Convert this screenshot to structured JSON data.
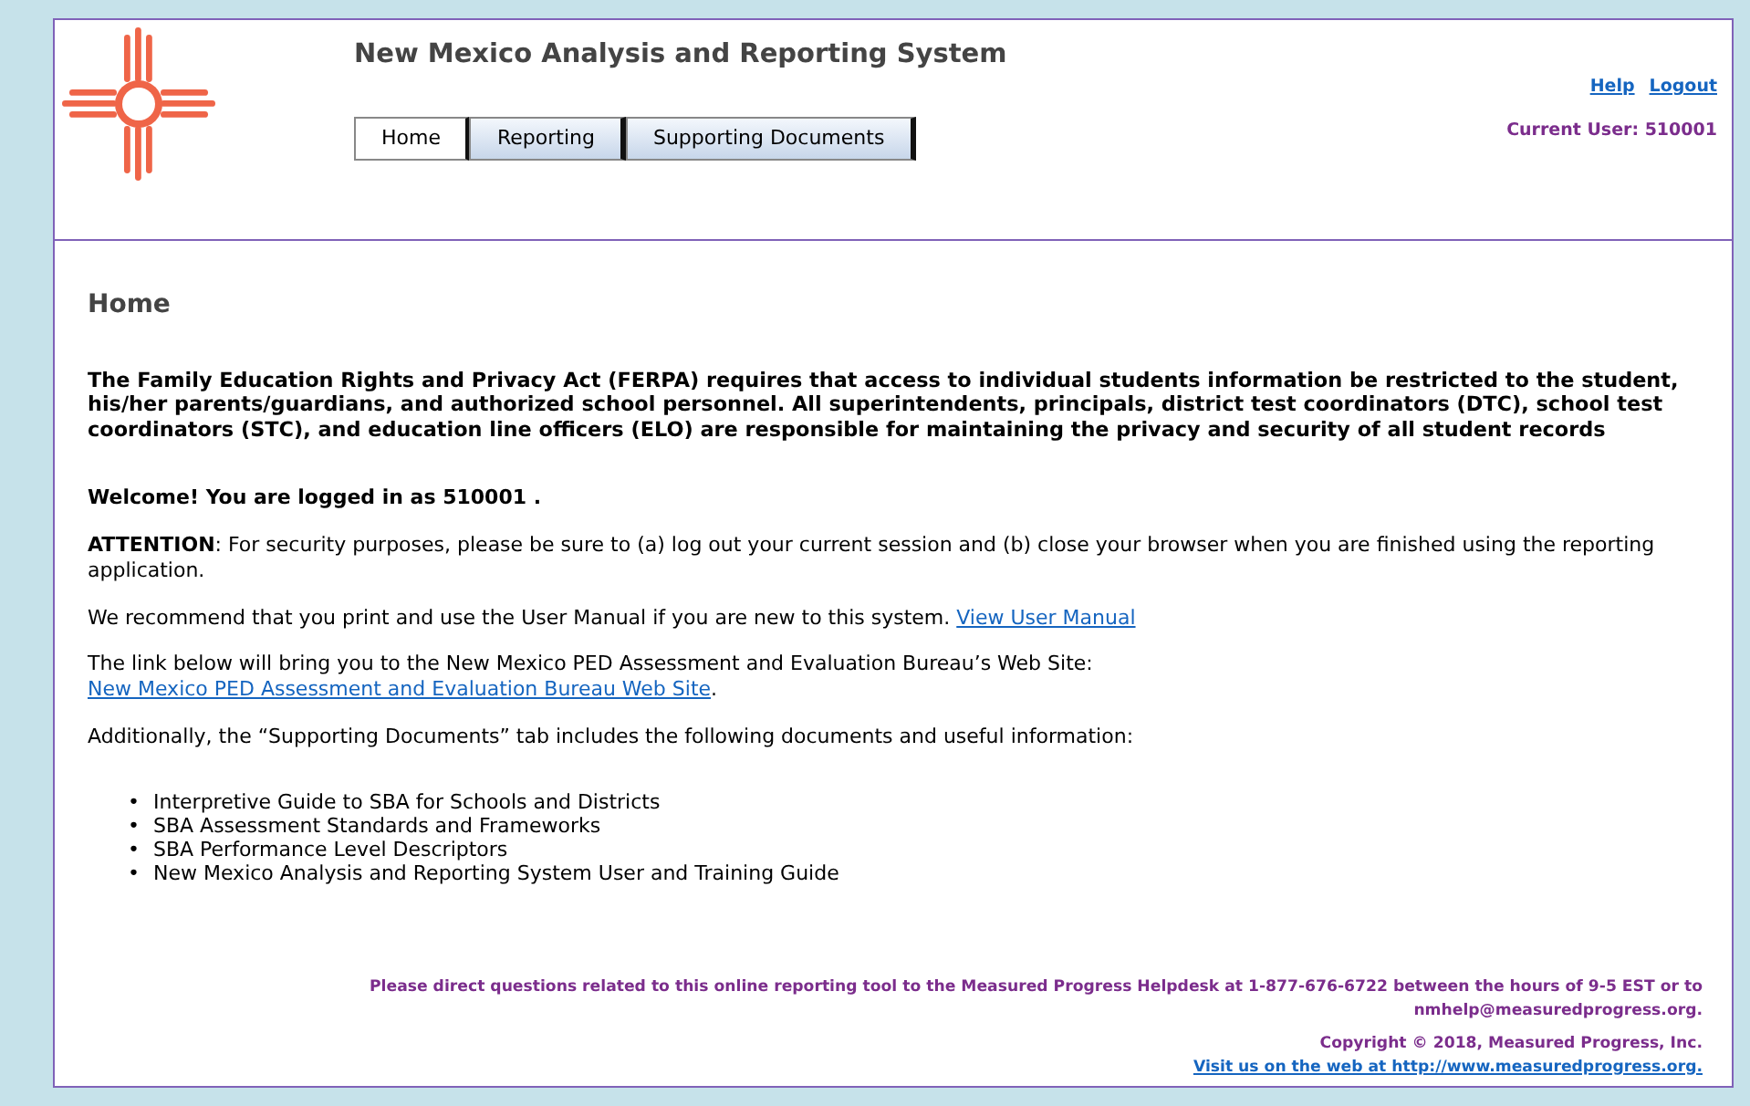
{
  "header": {
    "title": "New Mexico Analysis and Reporting System",
    "links": [
      "Help",
      "Logout"
    ],
    "current_user": "Current User: 510001"
  },
  "tabs": [
    {
      "label": "Home",
      "selected": true
    },
    {
      "label": "Reporting",
      "selected": false
    },
    {
      "label": "Supporting Documents",
      "selected": false
    }
  ],
  "page_title": "Home",
  "notice": "The Family Education Rights and Privacy Act (FERPA) requires that access to individual students information be restricted to the student, his/her parents/guardians, and authorized school personnel. All superintendents, principals, district test coordinators (DTC), school test coordinators (STC), and education line officers (ELO) are responsible for maintaining the privacy and security of all student records",
  "welcome": "Welcome! You are logged in as 510001 .",
  "paragraphs": [
    {
      "kind": "text",
      "text": "**ATTENTION**: For security purposes, please be sure to (a) log out your current session and (b) close your browser when you are finished using the reporting application."
    },
    {
      "kind": "inline-link",
      "text": "We recommend that you print and use the User Manual if you are new to this system.",
      "link": "View User Manual"
    },
    {
      "kind": "break-link",
      "text": "The link below will bring you to the New Mexico PED Assessment and Evaluation Bureau’s Web Site:",
      "link": "New Mexico PED Assessment and Evaluation Bureau Web Site",
      "after": "."
    },
    {
      "kind": "text",
      "text": "Additionally, the “Supporting Documents” tab includes the following documents and useful information:"
    }
  ],
  "documents": [
    {
      "bullet": "•",
      "text": "Interpretive Guide to SBA for Schools and Districts"
    },
    {
      "bullet": "•",
      "text": "SBA Assessment Standards and Frameworks"
    },
    {
      "bullet": "•",
      "text": "SBA Performance Level Descriptors"
    },
    {
      "bullet": "•",
      "text": "New Mexico Analysis and Reporting System User and Training Guide"
    }
  ],
  "footer": {
    "helpdesk": "Please direct questions related to this online reporting tool to the Measured Progress Helpdesk at 1-877-676-6722 between the hours of 9-5 EST or to nmhelp@measuredprogress.org.",
    "copyright": "Copyright © 2018, Measured Progress, Inc.",
    "website_link": "Visit us on the web at http://www.measuredprogress.org."
  }
}
